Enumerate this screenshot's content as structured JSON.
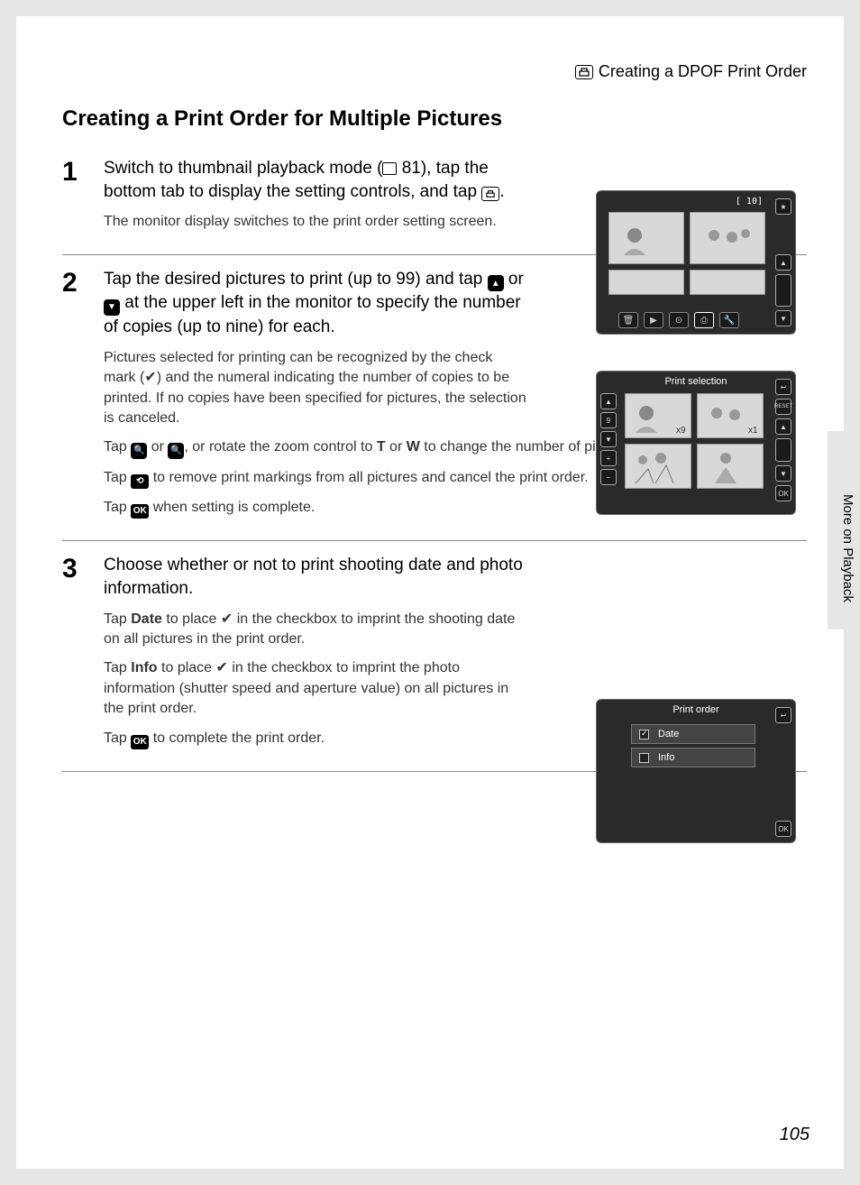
{
  "header": {
    "breadcrumb": "Creating a DPOF Print Order"
  },
  "title": "Creating a Print Order for Multiple Pictures",
  "sideLabel": "More on Playback",
  "pageNumber": "105",
  "steps": [
    {
      "num": "1",
      "heading_a": "Switch to thumbnail playback mode (",
      "heading_ref": "81",
      "heading_b": "), tap the bottom tab to display the setting controls, and tap ",
      "heading_c": ".",
      "notes": [
        "The monitor display switches to the print order setting screen."
      ]
    },
    {
      "num": "2",
      "heading_a": "Tap the desired pictures to print (up to 99) and tap ",
      "heading_b": " or ",
      "heading_c": " at the upper left in the monitor to specify the number of copies (up to nine) for each.",
      "notes": [
        "Pictures selected for printing can be recognized by the check mark (✔) and the numeral indicating the number of copies to be printed. If no copies have been specified for pictures, the selection is canceled."
      ],
      "note2_a": "Tap ",
      "note2_b": " or ",
      "note2_c": ", or rotate the zoom control to ",
      "note2_t": "T",
      "note2_d": " or ",
      "note2_w": "W",
      "note2_e": " to change the number of pictures displayed.",
      "note3_a": "Tap ",
      "note3_b": " to remove print markings from all pictures and cancel the print order.",
      "note4_a": "Tap ",
      "note4_b": " when setting is complete."
    },
    {
      "num": "3",
      "heading": "Choose whether or not to print shooting date and photo information.",
      "note1_a": "Tap ",
      "note1_bold": "Date",
      "note1_b": " to place ",
      "note1_c": " in the checkbox to imprint the shooting date on all pictures in the print order.",
      "note2_a": "Tap ",
      "note2_bold": "Info",
      "note2_b": " to place ",
      "note2_c": " in the checkbox to imprint the photo information (shutter speed and aperture value) on all pictures in the print order.",
      "note3_a": "Tap ",
      "note3_b": " to complete the print order."
    }
  ],
  "screenshots": {
    "ss1": {
      "counter": "10"
    },
    "ss2": {
      "title": "Print selection",
      "count": "9",
      "reset": "RESET",
      "ok": "OK"
    },
    "ss3": {
      "title": "Print order",
      "row1": "Date",
      "row2": "Info",
      "ok": "OK"
    }
  },
  "icons": {
    "ok": "OK"
  }
}
